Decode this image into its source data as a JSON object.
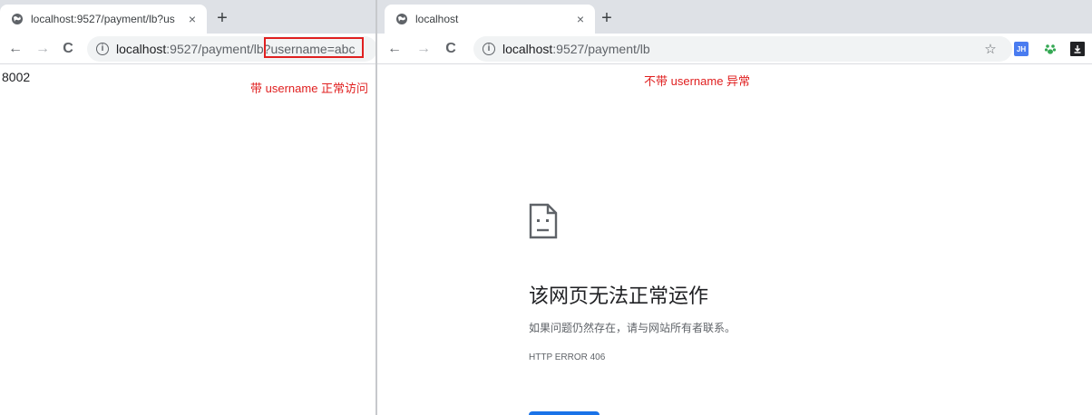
{
  "left_window": {
    "tab_title": "localhost:9527/payment/lb?us",
    "tab_close": "×",
    "new_tab": "+",
    "url_host": "localhost",
    "url_path": ":9527/payment/lb?username=abc",
    "page_text": "8002",
    "annotation": "带 username 正常访问"
  },
  "right_window": {
    "tab_title": "localhost",
    "tab_close": "×",
    "new_tab": "+",
    "url_host": "localhost",
    "url_path": ":9527/payment/lb",
    "annotation": "不带 username 异常",
    "error": {
      "title": "该网页无法正常运作",
      "description": "如果问题仍然存在，请与网站所有者联系。",
      "code": "HTTP ERROR 406"
    },
    "extensions": {
      "jh_label": "JH"
    }
  },
  "nav": {
    "back": "←",
    "forward": "→",
    "reload": "C",
    "info": "i"
  },
  "colors": {
    "annotation": "#e02020",
    "tab_strip": "#dee1e6",
    "omnibox": "#f1f3f4",
    "reload_button": "#1a73e8"
  },
  "icons": [
    "globe-icon",
    "close-icon",
    "plus-icon",
    "back-arrow-icon",
    "forward-arrow-icon",
    "reload-icon",
    "info-icon",
    "star-icon",
    "paw-icon",
    "download-icon",
    "sad-page-icon"
  ]
}
